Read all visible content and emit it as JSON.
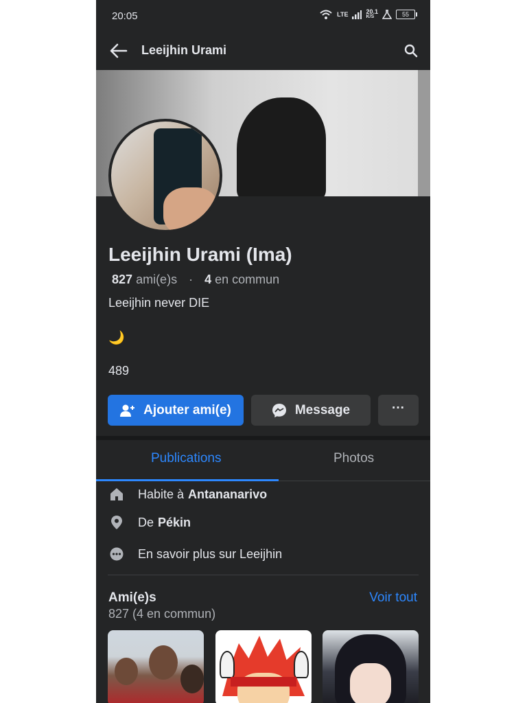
{
  "status_bar": {
    "time": "20:05",
    "network": "LTE",
    "speed": "20.1",
    "speed_unit": "K/S",
    "battery": "55"
  },
  "top_bar": {
    "title": "Leeijhin Urami"
  },
  "profile": {
    "name": "Leeijhin Urami (Ima)",
    "friends_count": "827",
    "friends_label": "ami(e)s",
    "mutual_count": "4",
    "mutual_label": "en commun",
    "bio_line1": "Leeijhin never DIE",
    "bio_emoji": "🌙",
    "bio_line3": "489"
  },
  "actions": {
    "add_friend": "Ajouter ami(e)",
    "message": "Message",
    "more": "···"
  },
  "tabs": [
    {
      "label": "Publications",
      "active": true
    },
    {
      "label": "Photos",
      "active": false
    }
  ],
  "info": {
    "lives_prefix": "Habite à",
    "lives_place": "Antananarivo",
    "from_prefix": "De",
    "from_place": "Pékin",
    "more_about": "En savoir plus sur Leeijhin"
  },
  "friends": {
    "title": "Ami(e)s",
    "see_all": "Voir tout",
    "count": "827 (4 en commun)"
  },
  "colors": {
    "background": "#242526",
    "accent": "#2d88ff",
    "primary_button": "#2374e1",
    "secondary_button": "#3a3b3c"
  }
}
